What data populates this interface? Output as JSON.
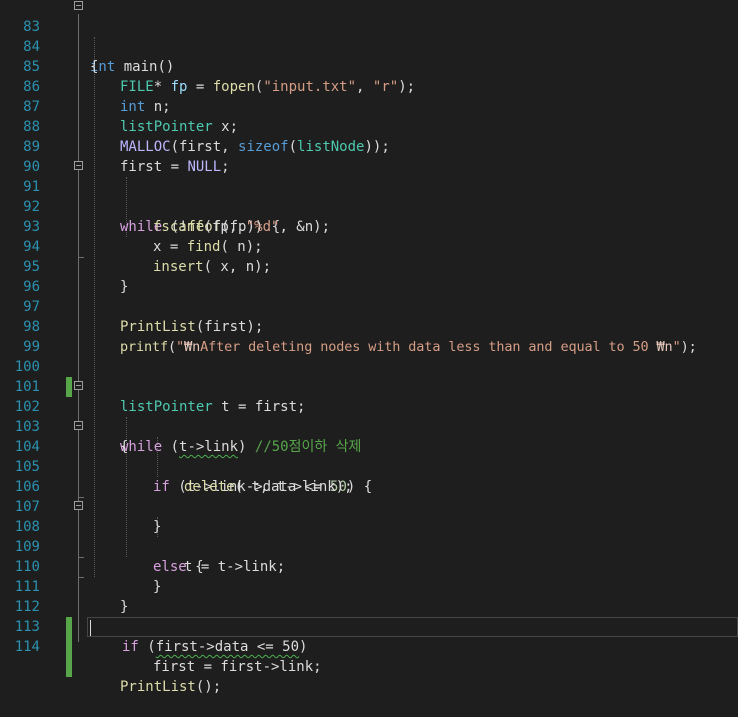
{
  "editor": {
    "line_numbers": [
      "83",
      "84",
      "85",
      "86",
      "87",
      "88",
      "89",
      "90",
      "91",
      "92",
      "93",
      "94",
      "95",
      "96",
      "97",
      "98",
      "99",
      "100",
      "101",
      "102",
      "103",
      "104",
      "105",
      "106",
      "107",
      "108",
      "109",
      "110",
      "111",
      "112",
      "113",
      "114"
    ],
    "code": {
      "l83": {
        "kw": "int",
        "rest": " main()"
      },
      "l84": {
        "t": "{"
      },
      "l85": {
        "type": "FILE",
        "a": "* ",
        "b": "fp",
        "c": " = ",
        "fn": "fopen",
        "d": "(",
        "s1": "\"input.txt\"",
        "e": ", ",
        "s2": "\"r\"",
        "f": ");"
      },
      "l86": {
        "kw": "int",
        "rest": " n;"
      },
      "l87": {
        "type": "listPointer",
        "rest": " x;"
      },
      "l88": {
        "mac": "MALLOC",
        "a": "(first, ",
        "kw": "sizeof",
        "b": "(",
        "type": "listNode",
        "c": "));"
      },
      "l89": {
        "a": "first = ",
        "mac": "NULL",
        "b": ";"
      },
      "l91": {
        "kw": "while",
        "a": " (!",
        "fn": "feof",
        "b": "(fp)) {"
      },
      "l92": {
        "fn": "fscanf",
        "a": "(fp, ",
        "s": "\"%d\"",
        "b": ", &n);"
      },
      "l93": {
        "a": "x = ",
        "fn": "find",
        "b": "( n);"
      },
      "l94": {
        "fn": "insert",
        "a": "( x, n);"
      },
      "l95": {
        "t": "}"
      },
      "l97": {
        "fn": "PrintList",
        "a": "(first);"
      },
      "l98": {
        "fn": "printf",
        "a": "(",
        "s1": "\"",
        "esc1": "₩n",
        "s2": "After deleting nodes with data less than and equal to 50 ",
        "esc2": "₩n",
        "s3": "\"",
        "b": ");"
      },
      "l100": {
        "type": "listPointer",
        "a": " t = first;"
      },
      "l102": {
        "kw": "while",
        "a": " (",
        "sq": "t->link",
        "b": ") ",
        "cm": "//50점이하 삭제"
      },
      "l103": {
        "t": "{"
      },
      "l104": {
        "kw": "if",
        "a": " (t->link->data <= ",
        "num": "50",
        "b": ") {"
      },
      "l105": {
        "fn": "delete",
        "a": "( t, t->link);"
      },
      "l107": {
        "t": "}"
      },
      "l108": {
        "kw": "else",
        "a": " {"
      },
      "l109": {
        "t": "t = t->link;"
      },
      "l110": {
        "t": "}"
      },
      "l111": {
        "t": "}"
      },
      "l112": {
        "kw": "if",
        "a": " (",
        "sq": "first->data <= 50",
        "b": ")"
      },
      "l113": {
        "t": "first = first->link;"
      },
      "l114": {
        "fn": "PrintList",
        "a": "();"
      }
    }
  }
}
